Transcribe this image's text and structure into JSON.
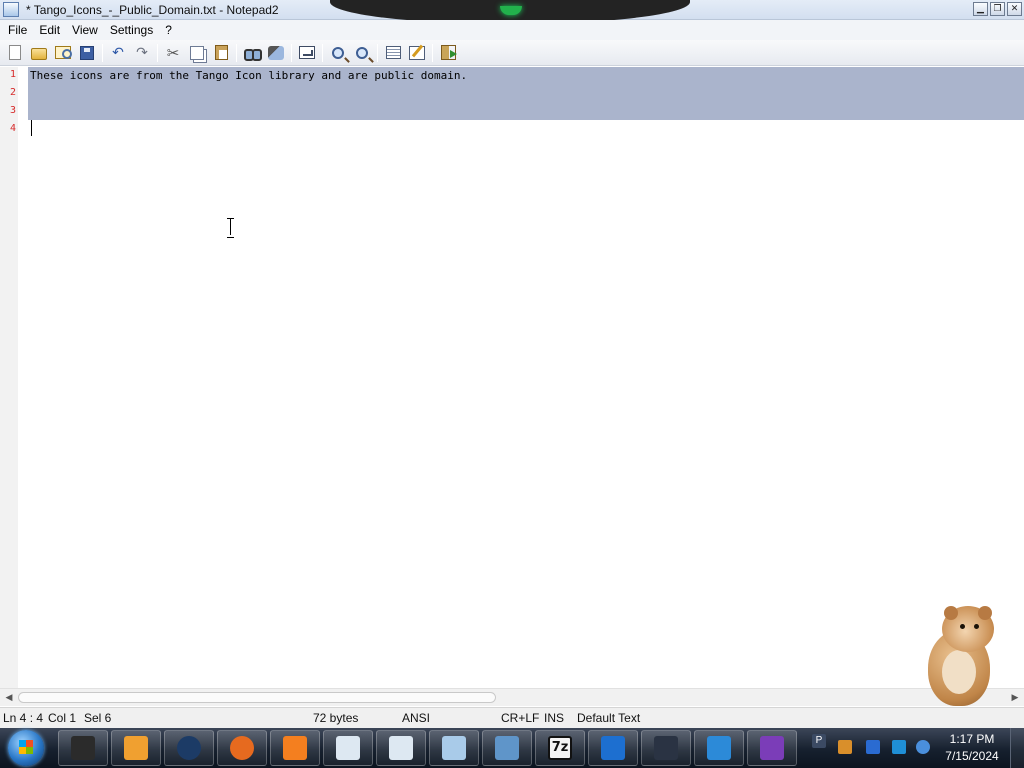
{
  "window": {
    "title": "* Tango_Icons_-_Public_Domain.txt - Notepad2",
    "controls": {
      "minimize": "▁",
      "restore": "❐",
      "close": "✕"
    }
  },
  "menu": {
    "items": [
      "File",
      "Edit",
      "View",
      "Settings",
      "?"
    ]
  },
  "toolbar": {
    "icons": [
      "new-icon",
      "open-icon",
      "browse-icon",
      "save-icon",
      "undo-icon",
      "redo-icon",
      "cut-icon",
      "copy-icon",
      "paste-icon",
      "find-icon",
      "replace-icon",
      "word-wrap-icon",
      "zoom-in-icon",
      "zoom-out-icon",
      "scheme-icon",
      "customize-scheme-icon",
      "exit-icon"
    ],
    "glyphs": {
      "undo": "↶",
      "redo": "↷",
      "cut": "✂"
    }
  },
  "editor": {
    "line_numbers": [
      "1",
      "2",
      "3",
      "4"
    ],
    "lines": [
      "These icons are from the Tango Icon library and are public domain.",
      "",
      "",
      ""
    ],
    "selection_color": "#aab4cc",
    "line_number_color": "#d72b2b"
  },
  "statusbar": {
    "position": "Ln 4 : 4",
    "column": "Col 1",
    "selection": "Sel 6",
    "size": "72 bytes",
    "encoding": "ANSI",
    "line_endings": "CR+LF",
    "insert_mode": "INS",
    "scheme": "Default Text"
  },
  "taskbar": {
    "apps": [
      {
        "name": "terminal",
        "color": "#2b2b2b"
      },
      {
        "name": "media-player",
        "color": "#f0a030"
      },
      {
        "name": "globe",
        "color": "#1c3b66"
      },
      {
        "name": "firefox",
        "color": "#e66a1f"
      },
      {
        "name": "goldfish",
        "color": "#f47f1f"
      },
      {
        "name": "document-viewer-1",
        "color": "#dde8f2"
      },
      {
        "name": "document-viewer-2",
        "color": "#dde8f2"
      },
      {
        "name": "notepad2",
        "color": "#a9cbe9"
      },
      {
        "name": "image-viewer",
        "color": "#5f95c9"
      },
      {
        "name": "7-zip",
        "color": "#f4f4f4"
      },
      {
        "name": "phone",
        "color": "#1d6fd0"
      },
      {
        "name": "monitor",
        "color": "#2a3343"
      },
      {
        "name": "internet-explorer",
        "color": "#2c8ad8"
      },
      {
        "name": "visual-studio",
        "color": "#7b3db8"
      }
    ],
    "sevenzip_label": "7z",
    "clock_time": "1:17 PM",
    "clock_date": "7/15/2024",
    "tray_letter": "P"
  }
}
